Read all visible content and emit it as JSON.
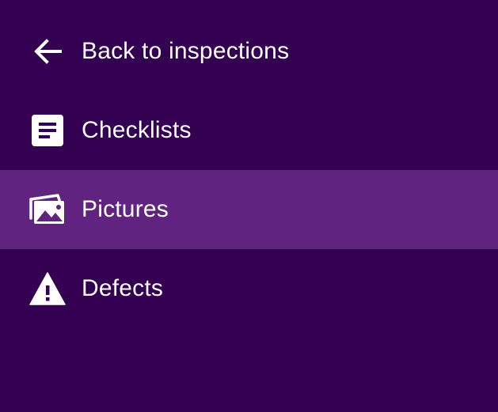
{
  "colors": {
    "background": "#330052",
    "active_background": "#612380",
    "text": "#ffffff"
  },
  "nav": {
    "items": [
      {
        "label": "Back to inspections",
        "icon": "arrow-back-icon",
        "active": false
      },
      {
        "label": "Checklists",
        "icon": "document-icon",
        "active": false
      },
      {
        "label": "Pictures",
        "icon": "photo-library-icon",
        "active": true
      },
      {
        "label": "Defects",
        "icon": "warning-icon",
        "active": false
      }
    ]
  }
}
